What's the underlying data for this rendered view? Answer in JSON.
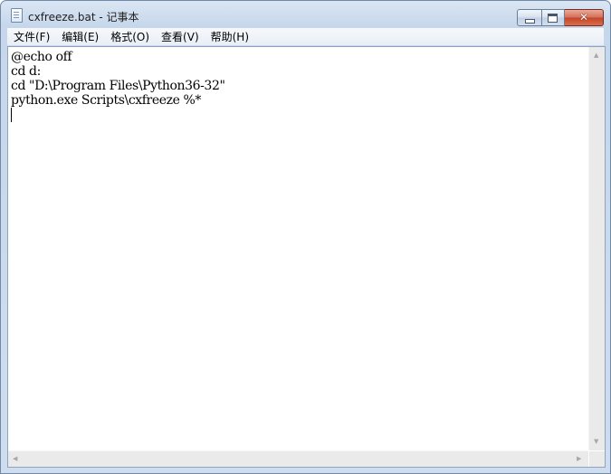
{
  "window": {
    "title": "cxfreeze.bat - 记事本"
  },
  "caption_buttons": {
    "close_glyph": "✕"
  },
  "menu": [
    {
      "label": "文件(F)"
    },
    {
      "label": "编辑(E)"
    },
    {
      "label": "格式(O)"
    },
    {
      "label": "查看(V)"
    },
    {
      "label": "帮助(H)"
    }
  ],
  "editor": {
    "lines": [
      "@echo off",
      "cd d:",
      "cd \"D:\\Program Files\\Python36-32\"",
      "python.exe Scripts\\cxfreeze %*"
    ]
  },
  "scrollbars": {
    "up_arrow": "▲",
    "down_arrow": "▼",
    "left_arrow": "◀",
    "right_arrow": "▶"
  },
  "icons": {
    "app": "notepad-icon",
    "minimize": "minimize-icon",
    "maximize": "maximize-icon",
    "close": "close-icon"
  }
}
